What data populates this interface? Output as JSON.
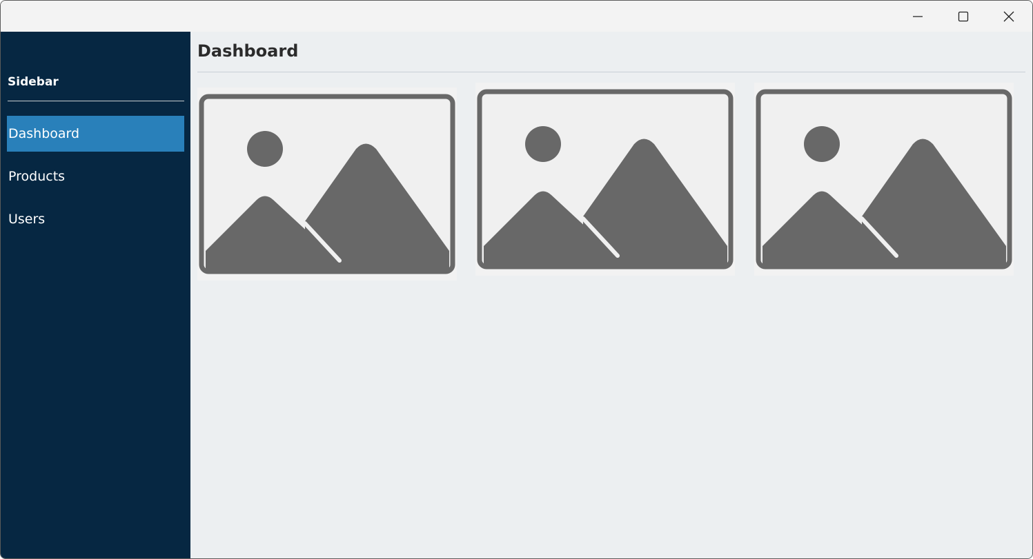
{
  "window": {
    "minimize_icon": "minimize-icon",
    "maximize_icon": "maximize-icon",
    "close_icon": "close-icon"
  },
  "sidebar": {
    "title": "Sidebar",
    "items": [
      {
        "label": "Dashboard",
        "active": true
      },
      {
        "label": "Products",
        "active": false
      },
      {
        "label": "Users",
        "active": false
      }
    ],
    "background": "#062742",
    "active_color": "#2980ba"
  },
  "main": {
    "title": "Dashboard",
    "cards": [
      {
        "icon": "image-placeholder-icon"
      },
      {
        "icon": "image-placeholder-icon"
      },
      {
        "icon": "image-placeholder-icon"
      }
    ]
  }
}
